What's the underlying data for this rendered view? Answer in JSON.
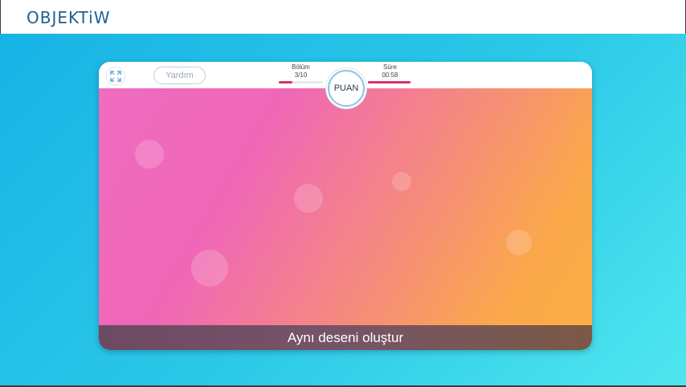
{
  "header": {
    "logo_text": "OBJEKTiW"
  },
  "game": {
    "help_label": "Yardım",
    "level": {
      "label": "Bölüm",
      "value": "3/10",
      "progress": 0.3
    },
    "time": {
      "label": "Süre",
      "value": "00:58",
      "progress": 0.97
    },
    "score_label": "PUAN",
    "instruction": "Aynı deseni oluştur"
  },
  "icons": {
    "fullscreen": "fullscreen-icon"
  },
  "colors": {
    "accent": "#d6336c",
    "logo": "#1f5f8f",
    "stage_start": "#18b3e6",
    "stage_end": "#4fe6ef"
  }
}
